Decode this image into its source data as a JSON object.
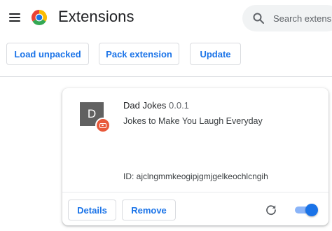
{
  "header": {
    "title": "Extensions",
    "menu_icon": "hamburger-menu-icon",
    "logo_icon": "chrome-logo-icon",
    "search": {
      "placeholder": "Search extensions",
      "icon": "search-icon"
    }
  },
  "toolbar": {
    "load_unpacked_label": "Load unpacked",
    "pack_extension_label": "Pack extension",
    "update_label": "Update"
  },
  "extension": {
    "icon_letter": "D",
    "name": "Dad Jokes",
    "version": "0.0.1",
    "description": "Jokes to Make You Laugh Everyday",
    "id_text": "ID: ajclngmmkeogipjgmjgelkeochlcngih",
    "details_label": "Details",
    "remove_label": "Remove",
    "reload_icon": "reload-icon",
    "enabled": true
  },
  "colors": {
    "accent": "#1a73e8",
    "badge": "#e8593a",
    "icon_bg": "#616161"
  }
}
